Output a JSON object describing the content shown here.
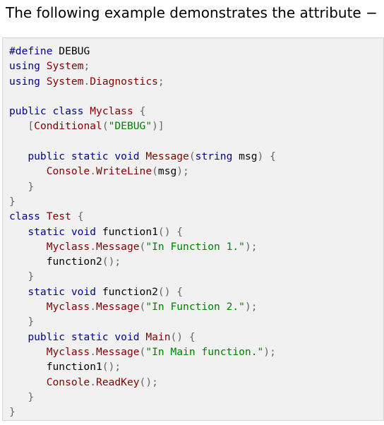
{
  "heading": "The following example demonstrates the attribute −",
  "colors": {
    "keyword": "#00008b",
    "type": "#800000",
    "string": "#008000",
    "punctuation": "#666666",
    "plain": "#000000",
    "code_background": "#f1f1f1"
  },
  "code": {
    "language": "csharp",
    "lines": [
      [
        [
          "kw",
          "#define"
        ],
        [
          "pl",
          " DEBUG"
        ]
      ],
      [
        [
          "kw",
          "using"
        ],
        [
          "pl",
          " "
        ],
        [
          "ty",
          "System"
        ],
        [
          "pu",
          ";"
        ]
      ],
      [
        [
          "kw",
          "using"
        ],
        [
          "pl",
          " "
        ],
        [
          "ty",
          "System"
        ],
        [
          "pu",
          "."
        ],
        [
          "ty",
          "Diagnostics"
        ],
        [
          "pu",
          ";"
        ]
      ],
      [],
      [
        [
          "kw",
          "public"
        ],
        [
          "pl",
          " "
        ],
        [
          "kw",
          "class"
        ],
        [
          "pl",
          " "
        ],
        [
          "ty",
          "Myclass"
        ],
        [
          "pl",
          " "
        ],
        [
          "pu",
          "{"
        ]
      ],
      [
        [
          "pl",
          "   "
        ],
        [
          "pu",
          "["
        ],
        [
          "ty",
          "Conditional"
        ],
        [
          "pu",
          "("
        ],
        [
          "st",
          "\"DEBUG\""
        ],
        [
          "pu",
          ")]"
        ]
      ],
      [],
      [
        [
          "pl",
          "   "
        ],
        [
          "kw",
          "public"
        ],
        [
          "pl",
          " "
        ],
        [
          "kw",
          "static"
        ],
        [
          "pl",
          " "
        ],
        [
          "kw",
          "void"
        ],
        [
          "pl",
          " "
        ],
        [
          "ty",
          "Message"
        ],
        [
          "pu",
          "("
        ],
        [
          "kw",
          "string"
        ],
        [
          "pl",
          " msg"
        ],
        [
          "pu",
          ")"
        ],
        [
          "pl",
          " "
        ],
        [
          "pu",
          "{"
        ]
      ],
      [
        [
          "pl",
          "      "
        ],
        [
          "ty",
          "Console"
        ],
        [
          "pu",
          "."
        ],
        [
          "ty",
          "WriteLine"
        ],
        [
          "pu",
          "("
        ],
        [
          "pl",
          "msg"
        ],
        [
          "pu",
          ");"
        ]
      ],
      [
        [
          "pl",
          "   "
        ],
        [
          "pu",
          "}"
        ]
      ],
      [
        [
          "pu",
          "}"
        ]
      ],
      [
        [
          "kw",
          "class"
        ],
        [
          "pl",
          " "
        ],
        [
          "ty",
          "Test"
        ],
        [
          "pl",
          " "
        ],
        [
          "pu",
          "{"
        ]
      ],
      [
        [
          "pl",
          "   "
        ],
        [
          "kw",
          "static"
        ],
        [
          "pl",
          " "
        ],
        [
          "kw",
          "void"
        ],
        [
          "pl",
          " function1"
        ],
        [
          "pu",
          "()"
        ],
        [
          "pl",
          " "
        ],
        [
          "pu",
          "{"
        ]
      ],
      [
        [
          "pl",
          "      "
        ],
        [
          "ty",
          "Myclass"
        ],
        [
          "pu",
          "."
        ],
        [
          "ty",
          "Message"
        ],
        [
          "pu",
          "("
        ],
        [
          "st",
          "\"In Function 1.\""
        ],
        [
          "pu",
          ");"
        ]
      ],
      [
        [
          "pl",
          "      function2"
        ],
        [
          "pu",
          "();"
        ]
      ],
      [
        [
          "pl",
          "   "
        ],
        [
          "pu",
          "}"
        ]
      ],
      [
        [
          "pl",
          "   "
        ],
        [
          "kw",
          "static"
        ],
        [
          "pl",
          " "
        ],
        [
          "kw",
          "void"
        ],
        [
          "pl",
          " function2"
        ],
        [
          "pu",
          "()"
        ],
        [
          "pl",
          " "
        ],
        [
          "pu",
          "{"
        ]
      ],
      [
        [
          "pl",
          "      "
        ],
        [
          "ty",
          "Myclass"
        ],
        [
          "pu",
          "."
        ],
        [
          "ty",
          "Message"
        ],
        [
          "pu",
          "("
        ],
        [
          "st",
          "\"In Function 2.\""
        ],
        [
          "pu",
          ");"
        ]
      ],
      [
        [
          "pl",
          "   "
        ],
        [
          "pu",
          "}"
        ]
      ],
      [
        [
          "pl",
          "   "
        ],
        [
          "kw",
          "public"
        ],
        [
          "pl",
          " "
        ],
        [
          "kw",
          "static"
        ],
        [
          "pl",
          " "
        ],
        [
          "kw",
          "void"
        ],
        [
          "pl",
          " "
        ],
        [
          "ty",
          "Main"
        ],
        [
          "pu",
          "()"
        ],
        [
          "pl",
          " "
        ],
        [
          "pu",
          "{"
        ]
      ],
      [
        [
          "pl",
          "      "
        ],
        [
          "ty",
          "Myclass"
        ],
        [
          "pu",
          "."
        ],
        [
          "ty",
          "Message"
        ],
        [
          "pu",
          "("
        ],
        [
          "st",
          "\"In Main function.\""
        ],
        [
          "pu",
          ");"
        ]
      ],
      [
        [
          "pl",
          "      function1"
        ],
        [
          "pu",
          "();"
        ]
      ],
      [
        [
          "pl",
          "      "
        ],
        [
          "ty",
          "Console"
        ],
        [
          "pu",
          "."
        ],
        [
          "ty",
          "ReadKey"
        ],
        [
          "pu",
          "();"
        ]
      ],
      [
        [
          "pl",
          "   "
        ],
        [
          "pu",
          "}"
        ]
      ],
      [
        [
          "pu",
          "}"
        ]
      ]
    ]
  }
}
